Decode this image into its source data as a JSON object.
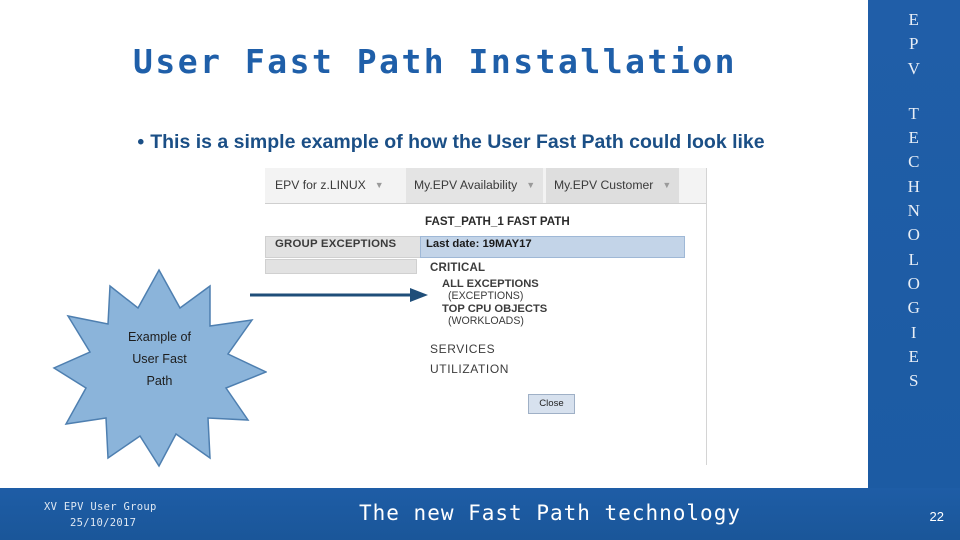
{
  "slide": {
    "title": "User Fast Path Installation",
    "bullet": {
      "marker": "•",
      "text": "This is a simple example of how the User Fast Path could look like"
    },
    "side_band": {
      "top_letters": [
        "E",
        "P",
        "V"
      ],
      "bottom_letters": [
        "T",
        "E",
        "C",
        "H",
        "N",
        "O",
        "L",
        "O",
        "G",
        "I",
        "E",
        "S"
      ]
    },
    "footer": {
      "left_line1": "XV EPV User Group",
      "left_line2": "25/10/2017",
      "center": "The new Fast Path technology",
      "page_number": "22"
    },
    "callout": {
      "line1": "Example of",
      "line2": "User Fast",
      "line3": "Path"
    },
    "screenshot": {
      "menu": [
        {
          "label": "EPV for z.LINUX",
          "caret": "▼"
        },
        {
          "label": "My.EPV Availability",
          "caret": "▼"
        },
        {
          "label": "My.EPV Customer",
          "caret": "▼"
        }
      ],
      "panel_title": "FAST_PATH_1 FAST PATH",
      "group_exceptions_label": "GROUP EXCEPTIONS",
      "last_date": "Last date: 19MAY17",
      "items": [
        "CRITICAL",
        "ALL EXCEPTIONS",
        "(EXCEPTIONS)",
        "TOP CPU OBJECTS",
        "(WORKLOADS)",
        "SERVICES",
        "UTILIZATION"
      ],
      "close_button": "Close"
    },
    "colors": {
      "brand_blue": "#1f5fa9",
      "title_blue": "#1f5fa9",
      "bullet_blue": "#1b4f86",
      "star_fill": "#8bb4da",
      "star_stroke": "#4e7fb0",
      "arrow": "#1f4e79"
    }
  }
}
